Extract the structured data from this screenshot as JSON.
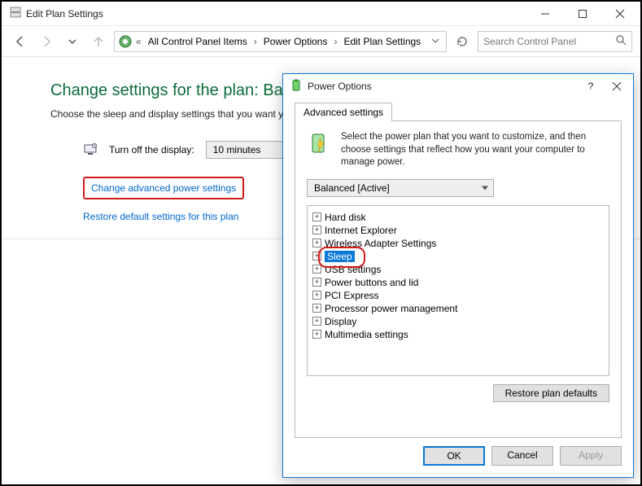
{
  "window": {
    "title": "Edit Plan Settings"
  },
  "breadcrumb": {
    "item1": "All Control Panel Items",
    "item2": "Power Options",
    "item3": "Edit Plan Settings"
  },
  "search": {
    "placeholder": "Search Control Panel"
  },
  "page": {
    "heading": "Change settings for the plan: Balanced",
    "subtext": "Choose the sleep and display settings that you want your computer to use.",
    "display_off_label": "Turn off the display:",
    "display_off_value": "10 minutes",
    "link_advanced": "Change advanced power settings",
    "link_restore": "Restore default settings for this plan"
  },
  "dialog": {
    "title": "Power Options",
    "help": "?",
    "tab": "Advanced settings",
    "description": "Select the power plan that you want to customize, and then choose settings that reflect how you want your computer to manage power.",
    "plan_selected": "Balanced [Active]",
    "tree": [
      "Hard disk",
      "Internet Explorer",
      "Wireless Adapter Settings",
      "Sleep",
      "USB settings",
      "Power buttons and lid",
      "PCI Express",
      "Processor power management",
      "Display",
      "Multimedia settings"
    ],
    "restore_defaults": "Restore plan defaults",
    "ok": "OK",
    "cancel": "Cancel",
    "apply": "Apply"
  }
}
